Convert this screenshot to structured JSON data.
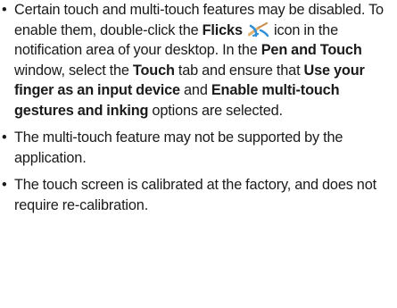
{
  "bullets": [
    {
      "t1": "Certain touch and multi-touch features may be disabled. To enable them, double-click the ",
      "flicks": "Flicks",
      "t2": " icon in the notification area of your desktop. In the ",
      "pen_touch": "Pen and Touch",
      "t3": " window, select the ",
      "touch_tab": "Touch",
      "t4": " tab and ensure that ",
      "use_finger": "Use your finger as an input device",
      "t5": " and ",
      "enable_multi": "Enable multi-touch gestures and inking",
      "t6": " options are selected."
    },
    {
      "text": "The multi-touch feature may not be supported by the application."
    },
    {
      "text": "The touch screen is calibrated at the factory, and does not require re-calibration."
    }
  ],
  "bullet_symbol": "•",
  "icons": {
    "flicks": "flicks-pen-icon"
  },
  "colors": {
    "text": "#1a1a1a",
    "icon_pen_blue": "#2f8fd8",
    "icon_pen_tan": "#e0b070"
  }
}
